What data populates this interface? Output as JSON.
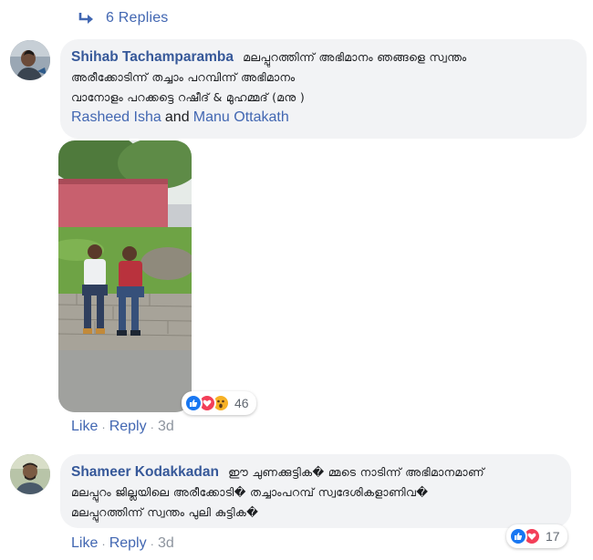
{
  "replies": {
    "label": "6 Replies"
  },
  "comments": [
    {
      "author": "Shihab Tachamparamba",
      "lines": [
        "മലപ്പുറത്തിന്ന് അഭിമാനം ഞങ്ങളെ സ്വന്തം",
        "അരീക്കോടിന്ന് തച്ചാം പറമ്പിന്ന് അഭിമാനം",
        "വാനോളം പറക്കട്ടെ റഷീദ് & മുഹമ്മദ് (മനു )"
      ],
      "mention1": "Rasheed Isha",
      "mention_joiner": "and",
      "mention2": "Manu Ottakath",
      "reactions": {
        "icons": [
          "like-icon",
          "love-icon",
          "wow-icon"
        ],
        "count": "46"
      },
      "actions": {
        "like": "Like",
        "reply": "Reply",
        "time": "3d"
      }
    },
    {
      "author": "Shameer Kodakkadan",
      "lines": [
        "ഈ ചുണക്കുട്ടിക� മ്മടെ നാടിന്ന് അഭിമാനമാണ്",
        "മലപ്പുറം ജില്ലയിലെ അരീക്കോടി� തച്ചാംപറമ്പ് സ്വദേശികളാണിവ�",
        "മലപ്പുറത്തിന്ന് സ്വന്തം പുലി കുട്ടിക�"
      ],
      "reactions": {
        "icons": [
          "like-icon",
          "love-icon"
        ],
        "count": "17"
      },
      "actions": {
        "like": "Like",
        "reply": "Reply",
        "time": "3d"
      }
    }
  ],
  "colors": {
    "link": "#4267b2",
    "author": "#365899",
    "bubble": "#f2f3f5",
    "muted": "#8d949e"
  }
}
